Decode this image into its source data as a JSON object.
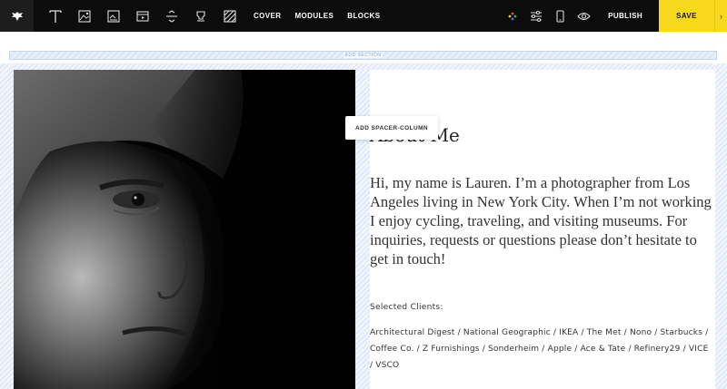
{
  "toolbar": {
    "nav": [
      "COVER",
      "MODULES",
      "BLOCKS"
    ],
    "publish_label": "PUBLISH",
    "save_label": "SAVE",
    "tools": [
      "text-tool-icon",
      "image-tool-icon",
      "gallery-tool-icon",
      "video-tool-icon",
      "spacer-tool-icon",
      "stamp-tool-icon",
      "pattern-tool-icon"
    ],
    "right_icons": [
      "color-palette-icon",
      "settings-sliders-icon",
      "mobile-preview-icon",
      "preview-eye-icon"
    ],
    "save_color": "#f7d81c"
  },
  "add_section_label": "ADD SECTION",
  "tooltip_label": "ADD SPACER-COLUMN",
  "content": {
    "heading": "About Me",
    "bio": "Hi, my name is Lauren. I’m a photographer from Los Angeles living in New York City. When I’m not working I enjoy cycling, traveling, and visiting museums. For inquiries, requests or questions please don’t hesitate to get in touch!",
    "clients_label": "Selected Clients:",
    "clients": "Architectural Digest / National Geographic / IKEA / The Met / Nono / Starbucks / Coffee Co. / Z Furnishings / Sonderheim / Apple / Ace & Tate / Refinery29 / VICE / VSCO"
  }
}
